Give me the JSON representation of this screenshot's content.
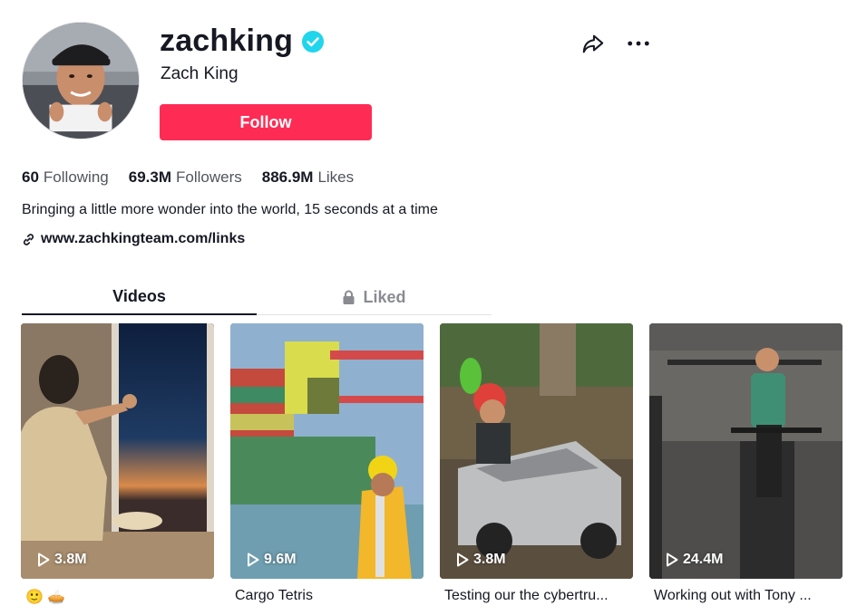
{
  "profile": {
    "username": "zachking",
    "display_name": "Zach King",
    "verified_icon": "verified-badge-icon",
    "follow_label": "Follow",
    "bio": "Bringing a little more wonder into the world, 15 seconds at a time",
    "link": "www.zachkingteam.com/links"
  },
  "stats": {
    "following_count": "60",
    "following_label": "Following",
    "followers_count": "69.3M",
    "followers_label": "Followers",
    "likes_count": "886.9M",
    "likes_label": "Likes"
  },
  "tabs": {
    "videos": "Videos",
    "liked": "Liked"
  },
  "videos": [
    {
      "views": "3.8M",
      "caption": "🙂 🥧"
    },
    {
      "views": "9.6M",
      "caption": "Cargo Tetris"
    },
    {
      "views": "3.8M",
      "caption": "Testing our the cybertru..."
    },
    {
      "views": "24.4M",
      "caption": "Working out with Tony ..."
    }
  ],
  "colors": {
    "follow_button": "#fe2c55",
    "verified": "#20d5ec",
    "text": "#161823"
  }
}
